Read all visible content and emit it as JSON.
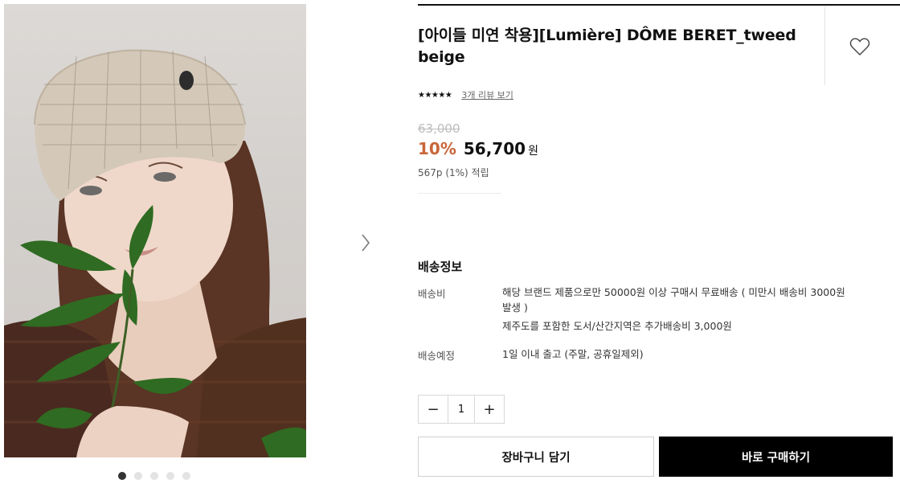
{
  "product": {
    "title_line1": "[아이들 미연 착용][Lumière] DÔME BERET_tweed",
    "title_line2": "beige",
    "image_alt": "model wearing beige tweed dome beret holding green leaves",
    "image_count": 5,
    "active_image": 1
  },
  "rating": {
    "stars": "★★★★★",
    "review_link": "3개 리뷰 보기"
  },
  "price": {
    "original": "63,000",
    "discount": "10%",
    "sale": "56,700",
    "currency": "원",
    "points": "567p (1%) 적립"
  },
  "shipping": {
    "section_title": "배송정보",
    "fee_label": "배송비",
    "fee_line1": "해당 브랜드 제품으로만 50000원 이상 구매시 무료배송 ( 미만시 배송비 3000원",
    "fee_line2": "발생 )",
    "fee_line3": "제주도를 포함한 도서/산간지역은 추가배송비 3,000원",
    "eta_label": "배송예정",
    "eta_value": "1일 이내 출고 (주말, 공휴일제외)"
  },
  "quantity": {
    "minus": "−",
    "value": "1",
    "plus": "+"
  },
  "buttons": {
    "cart": "장바구니 담기",
    "buy": "바로 구매하기"
  },
  "icons": {
    "wishlist": "heart-outline-icon",
    "next": "chevron-right-icon"
  },
  "colors": {
    "discount": "#c8663a",
    "buy_button": "#000000",
    "active_dot": "#333333"
  }
}
